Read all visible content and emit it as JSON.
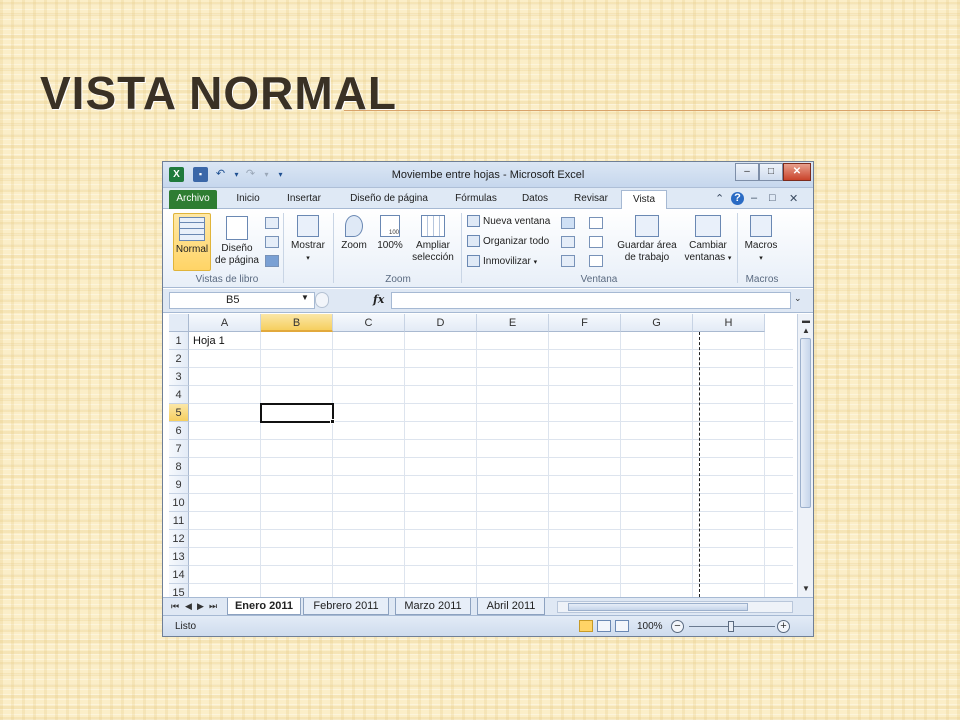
{
  "slide": {
    "title": "VISTA NORMAL"
  },
  "window": {
    "title": "Moviembe entre hojas  -  Microsoft Excel",
    "minimize": "–",
    "maximize": "□",
    "close": "✕"
  },
  "quick_access": {
    "undo": "↶",
    "redo": "↷",
    "customize": "▾"
  },
  "tabs": [
    {
      "label": "Archivo"
    },
    {
      "label": "Inicio"
    },
    {
      "label": "Insertar"
    },
    {
      "label": "Diseño de página"
    },
    {
      "label": "Fórmulas"
    },
    {
      "label": "Datos"
    },
    {
      "label": "Revisar"
    },
    {
      "label": "Vista"
    }
  ],
  "ribbon": {
    "groups": {
      "vistas": "Vistas de libro",
      "zoom": "Zoom",
      "ventana": "Ventana",
      "macros": "Macros"
    },
    "buttons": {
      "normal": "Normal",
      "diseno_1": "Diseño",
      "diseno_2": "de página",
      "mostrar": "Mostrar",
      "zoom": "Zoom",
      "zoom100": "100%",
      "zoom100_badge": "100",
      "ampliar_1": "Ampliar",
      "ampliar_2": "selección",
      "nueva_ventana": "Nueva ventana",
      "organizar": "Organizar todo",
      "inmovilizar": "Inmovilizar",
      "guardar_1": "Guardar área",
      "guardar_2": "de trabajo",
      "cambiar_1": "Cambiar",
      "cambiar_2": "ventanas",
      "macros": "Macros"
    }
  },
  "formula_bar": {
    "name_box": "B5",
    "fx": "fx",
    "value": ""
  },
  "grid": {
    "columns": [
      "A",
      "B",
      "C",
      "D",
      "E",
      "F",
      "G",
      "H"
    ],
    "rows": [
      "1",
      "2",
      "3",
      "4",
      "5",
      "6",
      "7",
      "8",
      "9",
      "10",
      "11",
      "12",
      "13",
      "14",
      "15"
    ],
    "active_cell": "B5",
    "cells": {
      "A1": "Hoja 1"
    }
  },
  "sheet_tabs": [
    {
      "label": "Enero 2011",
      "active": true
    },
    {
      "label": "Febrero 2011",
      "active": false
    },
    {
      "label": "Marzo 2011",
      "active": false
    },
    {
      "label": "Abril 2011",
      "active": false
    }
  ],
  "status": {
    "text": "Listo",
    "zoom": "100%",
    "zoom_out": "−",
    "zoom_in": "+"
  }
}
